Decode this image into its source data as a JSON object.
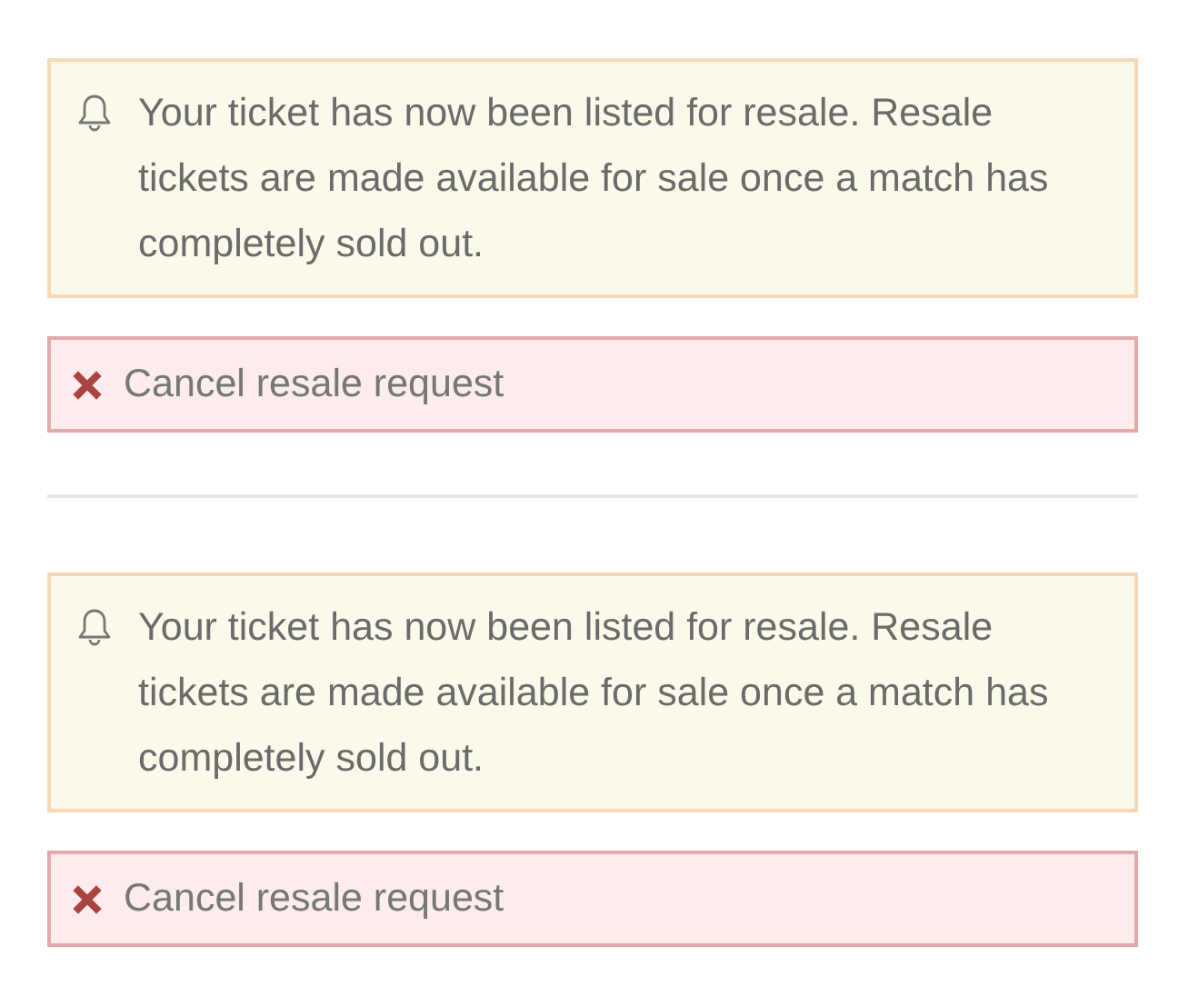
{
  "listings": [
    {
      "notice": "Your ticket has now been listed for resale. Resale tickets are made available for sale once a match has completely sold out.",
      "cancel_button": "Cancel resale request"
    },
    {
      "notice": "Your ticket has now been listed for resale. Resale tickets are made available for sale once a match has completely sold out.",
      "cancel_button": "Cancel resale request"
    }
  ]
}
